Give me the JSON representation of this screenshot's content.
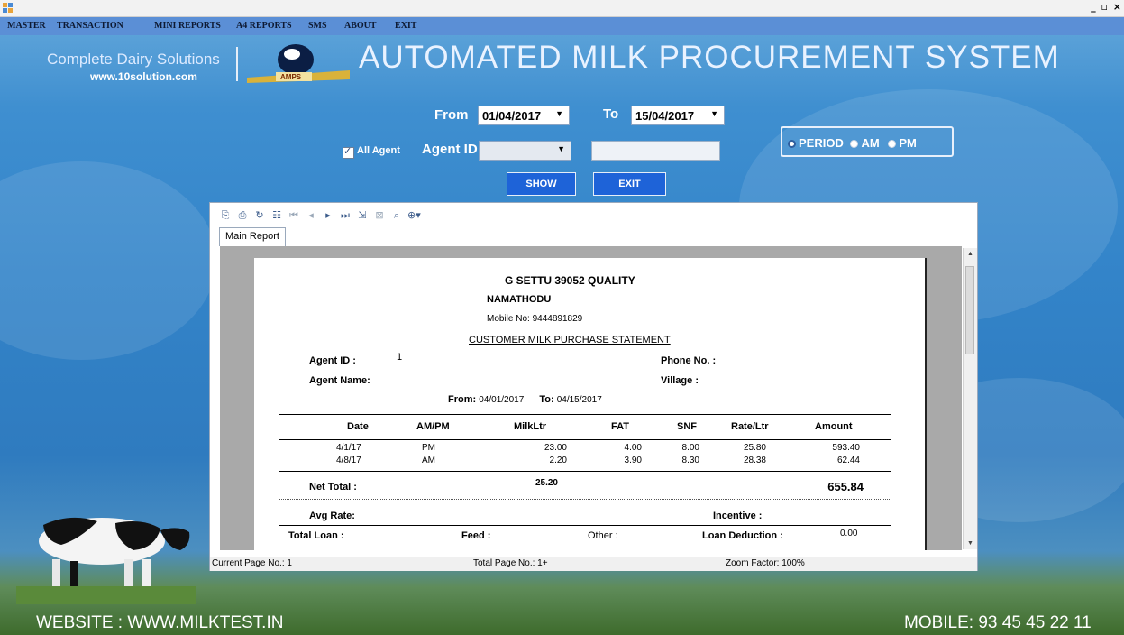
{
  "window": {
    "controls": "_ ▫ ×"
  },
  "menu": {
    "items": [
      "MASTER",
      "TRANSACTION",
      "MINI REPORTS",
      "A4 REPORTS",
      "SMS",
      "ABOUT",
      "EXIT"
    ]
  },
  "header": {
    "brand": "Complete Dairy Solutions",
    "brand_url": "www.10solution.com",
    "logo_text": "AMPS",
    "app_title": "AUTOMATED MILK PROCUREMENT SYSTEM"
  },
  "filters": {
    "from_label": "From",
    "from_value": "01/04/2017",
    "to_label": "To",
    "to_value": "15/04/2017",
    "all_agent_label": "All Agent",
    "all_agent_checked": true,
    "agent_id_label": "Agent ID",
    "agent_id_value": "",
    "agent_name_value": "",
    "period_label": "PERIOD",
    "am_label": "AM",
    "pm_label": "PM",
    "show_label": "SHOW",
    "exit_label": "EXIT"
  },
  "viewer": {
    "tab_label": "Main Report",
    "status": {
      "current_page": "Current Page No.: 1",
      "total_page": "Total Page No.: 1+",
      "zoom": "Zoom Factor: 100%"
    }
  },
  "report": {
    "company": "G SETTU 39052 QUALITY",
    "place": "NAMATHODU",
    "mobile_label": "Mobile No:",
    "mobile_value": "9444891829",
    "statement_title": "CUSTOMER MILK PURCHASE STATEMENT",
    "agent_id_label": "Agent ID :",
    "agent_id_value": "1",
    "agent_name_label": "Agent  Name:",
    "phone_label": "Phone No. :",
    "village_label": "Village :",
    "from_label": "From:",
    "from_value": "04/01/2017",
    "to_label": "To:",
    "to_value": "04/15/2017",
    "columns": [
      "Date",
      "AM/PM",
      "MilkLtr",
      "FAT",
      "SNF",
      "Rate/Ltr",
      "Amount"
    ],
    "rows": [
      [
        "4/1/17",
        "PM",
        "23.00",
        "4.00",
        "8.00",
        "25.80",
        "593.40"
      ],
      [
        "4/8/17",
        "AM",
        "2.20",
        "3.90",
        "8.30",
        "28.38",
        "62.44"
      ]
    ],
    "net_total_label": "Net Total :",
    "net_total_ltr": "25.20",
    "net_total_amount": "655.84",
    "avg_rate_label": "Avg Rate:",
    "incentive_label": "Incentive :",
    "total_loan_label": "Total Loan :",
    "feed_label": "Feed :",
    "other_label": "Other :",
    "loan_deduction_label": "Loan Deduction :",
    "loan_deduction_value": "0.00"
  },
  "footer": {
    "website": "WEBSITE : WWW.MILKTEST.IN",
    "mobile": "MOBILE: 93 45 45 22 11"
  },
  "colors": {
    "menubar": "#5b8fd6",
    "button": "#1e63d8",
    "sky": "#3384c9"
  }
}
